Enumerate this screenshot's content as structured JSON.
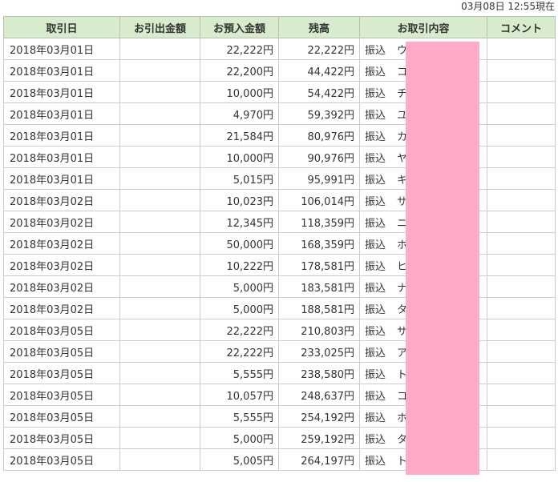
{
  "header": {
    "timestamp": "03月08日 12:55現在"
  },
  "table": {
    "columns": {
      "date": "取引日",
      "withdrawal": "お引出金額",
      "deposit": "お預入金額",
      "balance": "残高",
      "description": "お取引内容",
      "comment": "コメント"
    },
    "rows": [
      {
        "date": "2018年03月01日",
        "withdrawal": "",
        "deposit": "22,222円",
        "balance": "22,222円",
        "type": "振込",
        "payer": "ウ",
        "comment": ""
      },
      {
        "date": "2018年03月01日",
        "withdrawal": "",
        "deposit": "22,200円",
        "balance": "44,422円",
        "type": "振込",
        "payer": "コ",
        "comment": ""
      },
      {
        "date": "2018年03月01日",
        "withdrawal": "",
        "deposit": "10,000円",
        "balance": "54,422円",
        "type": "振込",
        "payer": "チ",
        "comment": ""
      },
      {
        "date": "2018年03月01日",
        "withdrawal": "",
        "deposit": "4,970円",
        "balance": "59,392円",
        "type": "振込",
        "payer": "ユ",
        "comment": ""
      },
      {
        "date": "2018年03月01日",
        "withdrawal": "",
        "deposit": "21,584円",
        "balance": "80,976円",
        "type": "振込",
        "payer": "カ",
        "comment": ""
      },
      {
        "date": "2018年03月01日",
        "withdrawal": "",
        "deposit": "10,000円",
        "balance": "90,976円",
        "type": "振込",
        "payer": "ヤ",
        "comment": ""
      },
      {
        "date": "2018年03月01日",
        "withdrawal": "",
        "deposit": "5,015円",
        "balance": "95,991円",
        "type": "振込",
        "payer": "キ",
        "comment": ""
      },
      {
        "date": "2018年03月02日",
        "withdrawal": "",
        "deposit": "10,023円",
        "balance": "106,014円",
        "type": "振込",
        "payer": "サ",
        "comment": ""
      },
      {
        "date": "2018年03月02日",
        "withdrawal": "",
        "deposit": "12,345円",
        "balance": "118,359円",
        "type": "振込",
        "payer": "ニ",
        "comment": ""
      },
      {
        "date": "2018年03月02日",
        "withdrawal": "",
        "deposit": "50,000円",
        "balance": "168,359円",
        "type": "振込",
        "payer": "ホ",
        "comment": ""
      },
      {
        "date": "2018年03月02日",
        "withdrawal": "",
        "deposit": "10,222円",
        "balance": "178,581円",
        "type": "振込",
        "payer": "ヒ",
        "comment": ""
      },
      {
        "date": "2018年03月02日",
        "withdrawal": "",
        "deposit": "5,000円",
        "balance": "183,581円",
        "type": "振込",
        "payer": "ナ",
        "comment": ""
      },
      {
        "date": "2018年03月02日",
        "withdrawal": "",
        "deposit": "5,000円",
        "balance": "188,581円",
        "type": "振込",
        "payer": "タ",
        "comment": ""
      },
      {
        "date": "2018年03月05日",
        "withdrawal": "",
        "deposit": "22,222円",
        "balance": "210,803円",
        "type": "振込",
        "payer": "サ",
        "comment": ""
      },
      {
        "date": "2018年03月05日",
        "withdrawal": "",
        "deposit": "22,222円",
        "balance": "233,025円",
        "type": "振込",
        "payer": "ア",
        "comment": ""
      },
      {
        "date": "2018年03月05日",
        "withdrawal": "",
        "deposit": "5,555円",
        "balance": "238,580円",
        "type": "振込",
        "payer": "ト",
        "comment": ""
      },
      {
        "date": "2018年03月05日",
        "withdrawal": "",
        "deposit": "10,057円",
        "balance": "248,637円",
        "type": "振込",
        "payer": "コ",
        "comment": ""
      },
      {
        "date": "2018年03月05日",
        "withdrawal": "",
        "deposit": "5,555円",
        "balance": "254,192円",
        "type": "振込",
        "payer": "ホ",
        "comment": ""
      },
      {
        "date": "2018年03月05日",
        "withdrawal": "",
        "deposit": "5,000円",
        "balance": "259,192円",
        "type": "振込",
        "payer": "タ",
        "comment": ""
      },
      {
        "date": "2018年03月05日",
        "withdrawal": "",
        "deposit": "5,005円",
        "balance": "264,197円",
        "type": "振込",
        "payer": "ト",
        "comment": ""
      }
    ]
  },
  "colors": {
    "header_background": "#d7eccd",
    "redaction": "#ffaac8"
  }
}
